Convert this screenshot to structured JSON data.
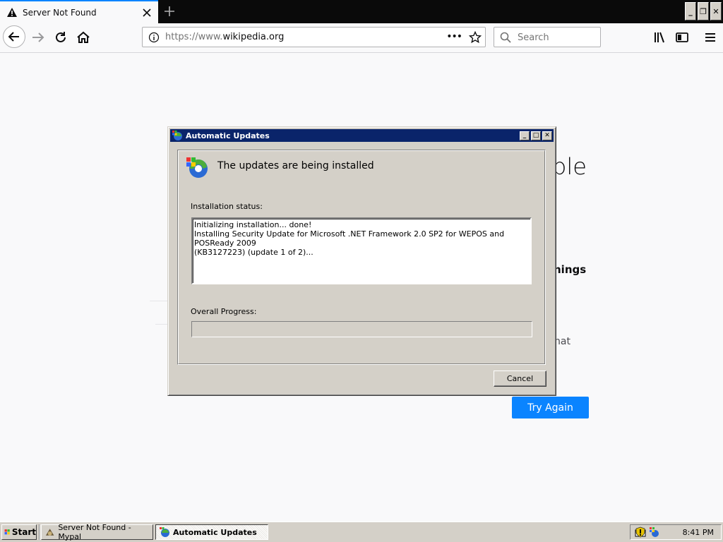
{
  "browser": {
    "tab_title": "Server Not Found",
    "url_scheme": "https://www.",
    "url_host": "wikipedia.org",
    "search_placeholder": "Search"
  },
  "page": {
    "title_fragment": "ble",
    "things_fragment": "hings",
    "hat_fragment": "hat",
    "try_again_label": "Try Again",
    "accent": "#0a84ff"
  },
  "dialog": {
    "title": "Automatic Updates",
    "heading": "The updates are being installed",
    "status_label": "Installation status:",
    "status_text": "Initializing installation... done!\nInstalling Security Update for Microsoft .NET Framework 2.0 SP2 for WEPOS and POSReady 2009\n(KB3127223) (update 1 of 2)...",
    "progress_label": "Overall Progress:",
    "progress_value": 0,
    "cancel_label": "Cancel",
    "titlebar_color": "#0a246a"
  },
  "taskbar": {
    "start_label": "Start",
    "tasks": [
      {
        "label": "Server Not Found - Mypal",
        "active": false
      },
      {
        "label": "Automatic Updates",
        "active": true
      }
    ],
    "clock": "8:41 PM"
  }
}
